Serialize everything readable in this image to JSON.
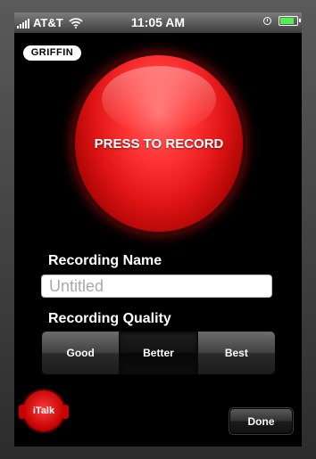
{
  "status_bar": {
    "carrier": "AT&T",
    "time": "11:05 AM",
    "battery_level": 0.86,
    "icons": [
      "signal-bars-icon",
      "wifi-icon",
      "alarm-clock-icon",
      "battery-icon"
    ]
  },
  "brand_logo": "GRIFFIN",
  "record_button": {
    "label": "PRESS TO RECORD",
    "color": "#e01414"
  },
  "recording_name": {
    "label": "Recording Name",
    "value": "",
    "placeholder": "Untitled"
  },
  "recording_quality": {
    "label": "Recording Quality",
    "options": [
      "Good",
      "Better",
      "Best"
    ],
    "selected": "Better"
  },
  "app_logo": "iTalk",
  "done_button": "Done",
  "colors": {
    "accent": "#e01414",
    "battery": "#4ef14e",
    "background": "#000000"
  }
}
